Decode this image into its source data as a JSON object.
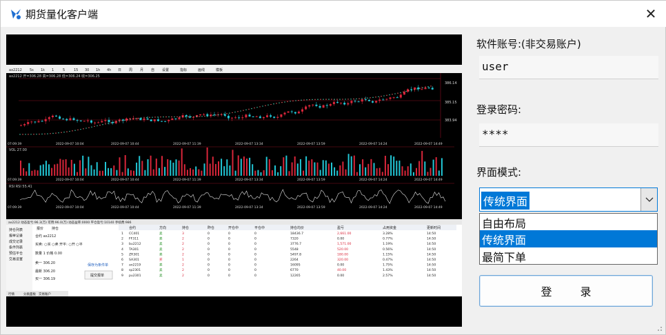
{
  "window": {
    "title": "期货量化客户端",
    "close_symbol": "✕"
  },
  "preview": {
    "toolbar": [
      "ax2212",
      "5s",
      "1k",
      "1",
      "5",
      "15",
      "30",
      "1h",
      "4h",
      "日",
      "周",
      "月",
      "自",
      "设置",
      "指标",
      "画线",
      "模板"
    ],
    "price_ticks": [
      "386.14",
      "385.15",
      "383.94"
    ],
    "time_ticks": [
      "07:09:39",
      "2022-09-07 10:04",
      "2022-09-07 10:44",
      "2022-09-07 11:39",
      "2022-09-07 13:34",
      "2022-09-07 13:59",
      "2022-09-07 14:24",
      "2022-09-07 14:49"
    ],
    "indicator_labels": {
      "vol": "VOL 27.00",
      "rsi": "RSI RSI 55.41"
    },
    "side_menu": [
      "持仓列表",
      "报单记录",
      "成交记录",
      "条件列表",
      "预估平仓",
      "交易设置"
    ],
    "order_tabs": [
      "报价",
      "持仓"
    ],
    "order_form": {
      "contract_label": "合约",
      "contract_value": "ax2212",
      "direction_label": "买卖",
      "buy": "买",
      "sell": "卖",
      "offset_label": "开平",
      "open": "开",
      "close": "平",
      "qty_label": "数量",
      "qty_value": "1",
      "price_label": "价格",
      "price_value": "0.00",
      "ask_label": "卖一",
      "ask_value": "306.20",
      "last_label": "最新",
      "last_value": "306.20",
      "bid_label": "买一",
      "bid_value": "306.19",
      "cond_link": "保存为条件单",
      "submit": "提交报单"
    },
    "position_headers": [
      "合约",
      "方向",
      "持仓",
      "昨仓",
      "开仓中",
      "平仓中",
      "持仓均价",
      "盈亏",
      "占用资金",
      "更新时间"
    ],
    "positions": [
      [
        "CC401",
        "卖",
        "3",
        "0",
        "0",
        "0",
        "18436.7",
        "2,661.00",
        "3.28%",
        "14:50"
      ],
      [
        "FF311",
        "卖",
        "2",
        "0",
        "0",
        "0",
        "7320",
        "0.00",
        "0.77%",
        "14:50"
      ],
      [
        "bu2212",
        "卖",
        "2",
        "0",
        "0",
        "0",
        "3776.7",
        "1,571.00",
        "1.19%",
        "14:50"
      ],
      [
        "TA301",
        "卖",
        "2",
        "0",
        "0",
        "0",
        "5548",
        "520.00",
        "0.56%",
        "14:50"
      ],
      [
        "ZR301",
        "卖",
        "2",
        "0",
        "0",
        "0",
        "5497.8",
        "180.00",
        "1.15%",
        "14:50"
      ],
      [
        "SA301",
        "买",
        "1",
        "0",
        "0",
        "0",
        "2264",
        "320.00",
        "0.47%",
        "14:50"
      ],
      [
        "ax2219",
        "卖",
        "2",
        "0",
        "0",
        "0",
        "16095",
        "0.00",
        "1.75%",
        "14:50"
      ],
      [
        "sp2301",
        "卖",
        "2",
        "0",
        "0",
        "0",
        "6770",
        "40.00",
        "1.43%",
        "14:50"
      ],
      [
        "pu2301",
        "卖",
        "2",
        "0",
        "0",
        "0",
        "12265",
        "0.00",
        "2.57%",
        "14:50"
      ]
    ],
    "status_tabs": [
      "行情",
      "分类面板",
      "交易账户"
    ]
  },
  "form": {
    "account_label": "软件账号:(非交易账户)",
    "account_value": "user",
    "password_label": "登录密码:",
    "password_value": "****",
    "mode_label": "界面模式:",
    "mode_selected": "传统界面",
    "mode_options": [
      "自由布局",
      "传统界面",
      "最简下单"
    ],
    "login_button": "登 录"
  },
  "colors": {
    "accent": "#0078d7",
    "chart_bg": "#000000",
    "candle_up": "#d9263a",
    "candle_down": "#22c7d6"
  }
}
